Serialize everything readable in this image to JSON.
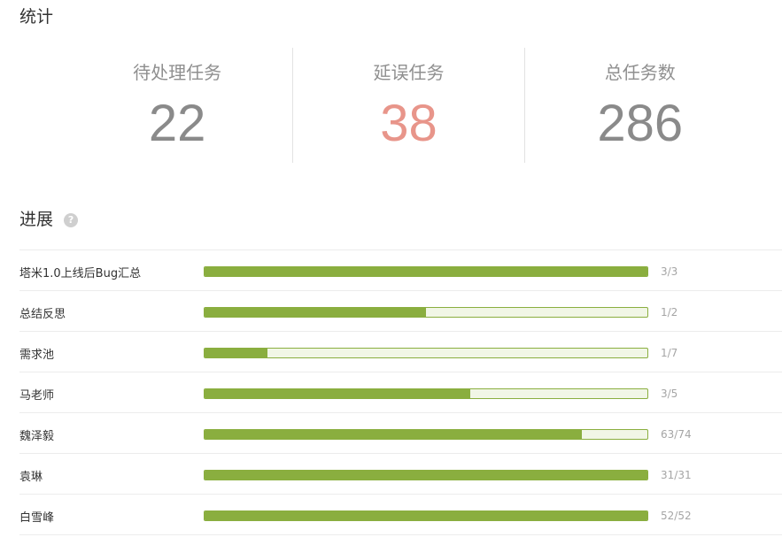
{
  "stats": {
    "title": "统计",
    "items": [
      {
        "label": "待处理任务",
        "value": "22"
      },
      {
        "label": "延误任务",
        "value": "38"
      },
      {
        "label": "总任务数",
        "value": "286"
      }
    ]
  },
  "progress": {
    "title": "进展",
    "help_icon": "?",
    "rows": [
      {
        "name": "塔米1.0上线后Bug汇总",
        "count": "3/3",
        "fraction": 1.0
      },
      {
        "name": "总结反思",
        "count": "1/2",
        "fraction": 0.5
      },
      {
        "name": "需求池",
        "count": "1/7",
        "fraction": 0.142857
      },
      {
        "name": "马老师",
        "count": "3/5",
        "fraction": 0.6
      },
      {
        "name": "魏泽毅",
        "count": "63/74",
        "fraction": 0.851351
      },
      {
        "name": "袁琳",
        "count": "31/31",
        "fraction": 1.0
      },
      {
        "name": "白雪峰",
        "count": "52/52",
        "fraction": 1.0
      }
    ]
  },
  "colors": {
    "progress_fill": "#8aae3f",
    "progress_track": "#f1f6e6",
    "delayed_value": "#e8958a",
    "stat_value": "#8a8a8a"
  }
}
